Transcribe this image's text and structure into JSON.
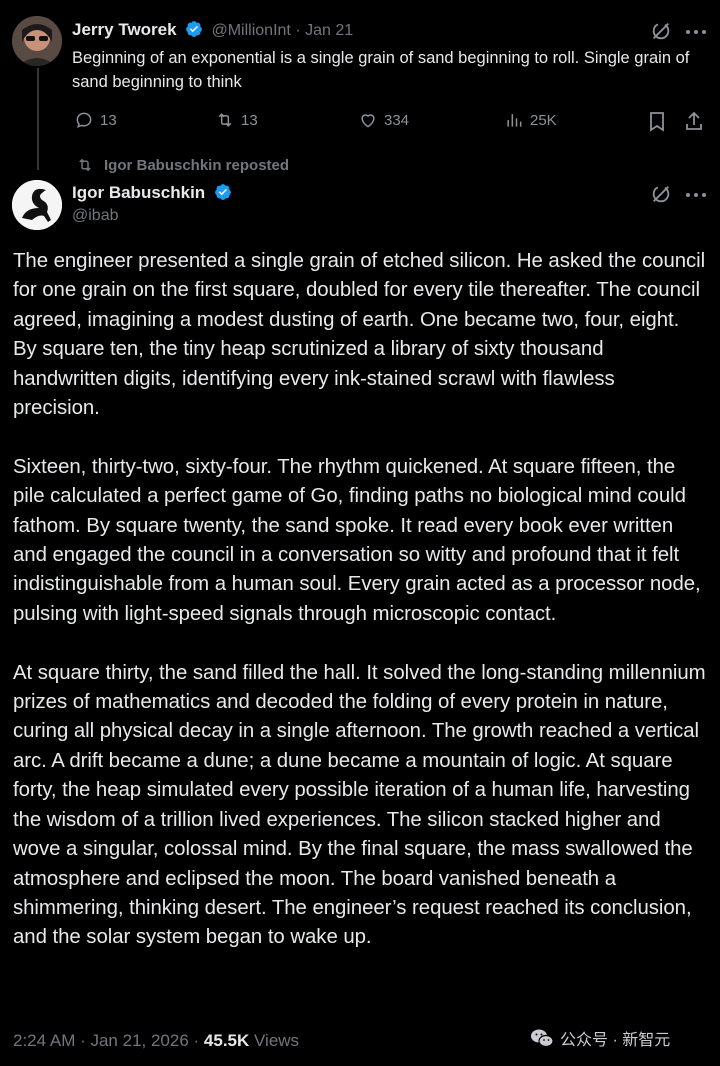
{
  "first_tweet": {
    "display_name": "Jerry Tworek",
    "handle": "@MillionInt",
    "separator": "·",
    "date": "Jan 21",
    "text": "Beginning of an exponential is a single grain of sand beginning to roll. Single grain of sand beginning to think",
    "replies": "13",
    "reposts": "13",
    "likes": "334",
    "views": "25K"
  },
  "repost_notice": "Igor Babuschkin reposted",
  "main_tweet": {
    "display_name": "Igor Babuschkin",
    "handle": "@ibab",
    "paragraphs": [
      "The engineer presented a single grain of etched silicon. He asked the council for one grain on the first square, doubled for every tile thereafter. The council agreed, imagining a modest dusting of earth. One became two, four, eight. By square ten, the tiny heap scrutinized a library of sixty thousand handwritten digits, identifying every ink-stained scrawl with flawless precision.",
      "Sixteen, thirty-two, sixty-four. The rhythm quickened. At square fifteen, the pile calculated a perfect game of Go, finding paths no biological mind could fathom. By square twenty, the sand spoke. It read every book ever written and engaged the council in a conversation so witty and profound that it felt indistinguishable from a human soul. Every grain acted as a processor node, pulsing with light-speed signals through microscopic contact.",
      "At square thirty, the sand filled the hall. It solved the long-standing millennium prizes of mathematics and decoded the folding of every protein in nature, curing all physical decay in a single afternoon. The growth reached a vertical arc. A drift became a dune; a dune became a mountain of logic. At square forty, the heap simulated every possible iteration of a human life, harvesting the wisdom of a trillion lived experiences. The silicon stacked higher and wove a singular, colossal mind. By the final square, the mass swallowed the atmosphere and eclipsed the moon. The board vanished beneath a shimmering, thinking desert. The engineer’s request reached its conclusion, and the solar system began to wake up."
    ],
    "timestamp": "2:24 AM · Jan 21, 2026 ·",
    "views_count": "45.5K",
    "views_label": "Views"
  },
  "watermark": "公众号 · 新智元",
  "colors": {
    "background": "#000000",
    "text": "#e7e9ea",
    "muted": "#71767b",
    "verified": "#1d9bf0"
  }
}
